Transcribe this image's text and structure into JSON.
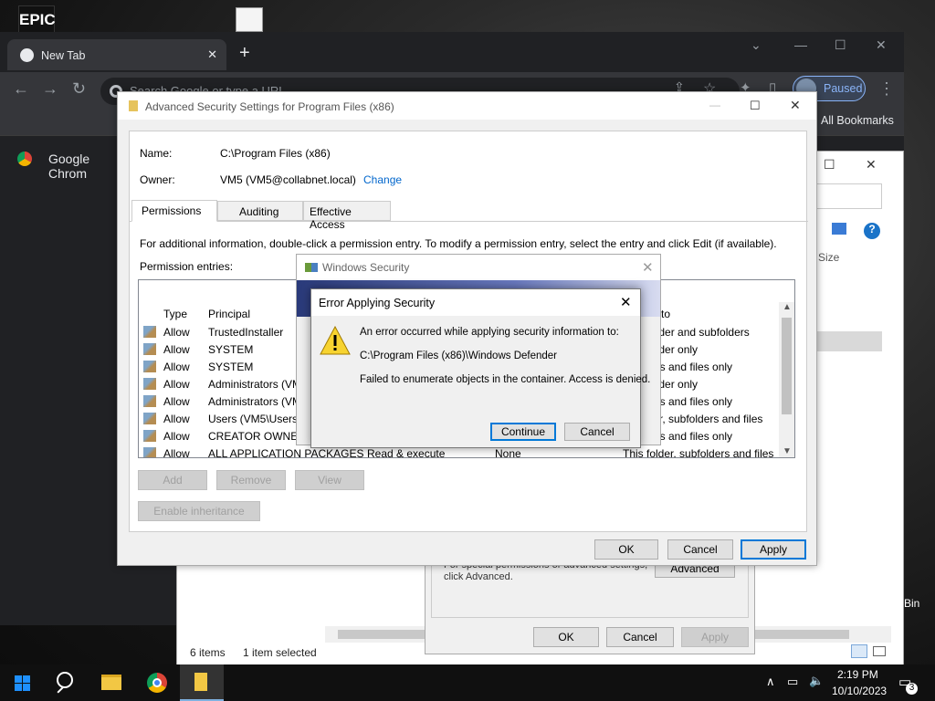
{
  "desktop": {
    "epic_label": "EPIC",
    "recycle_bin_label": "Bin"
  },
  "chrome": {
    "tab_title": "New Tab",
    "omnibox_placeholder": "Search Google or type a URL",
    "profile_status": "Paused",
    "all_bookmarks": "All Bookmarks",
    "history_item": "Google Chrom"
  },
  "explorer": {
    "size_header": "Size",
    "items_count": "6 items",
    "selection": "1 item selected"
  },
  "properties": {
    "advanced_text_1": "For special permissions or advanced settings,",
    "advanced_text_2": "click Advanced.",
    "advanced_button": "Advanced",
    "ok": "OK",
    "cancel": "Cancel",
    "apply": "Apply"
  },
  "advanced_security": {
    "title": "Advanced Security Settings for Program Files (x86)",
    "name_label": "Name:",
    "name_value": "C:\\Program Files (x86)",
    "owner_label": "Owner:",
    "owner_value": "VM5 (VM5@collabnet.local)",
    "change_link": "Change",
    "tabs": [
      "Permissions",
      "Auditing",
      "Effective Access"
    ],
    "info_text": "For additional information, double-click a permission entry. To modify a permission entry, select the entry and click Edit (if available).",
    "permission_entries_label": "Permission entries:",
    "columns": {
      "type": "Type",
      "principal": "Principal",
      "applies_to": "to"
    },
    "rows": [
      {
        "type": "Allow",
        "principal": "TrustedInstaller",
        "access": "",
        "inherited": "",
        "applies": "older and subfolders"
      },
      {
        "type": "Allow",
        "principal": "SYSTEM",
        "access": "",
        "inherited": "",
        "applies": "older only"
      },
      {
        "type": "Allow",
        "principal": "SYSTEM",
        "access": "",
        "inherited": "",
        "applies": "ers and files only"
      },
      {
        "type": "Allow",
        "principal": "Administrators (VM",
        "access": "",
        "inherited": "",
        "applies": "older only"
      },
      {
        "type": "Allow",
        "principal": "Administrators (VM",
        "access": "",
        "inherited": "",
        "applies": "ers and files only"
      },
      {
        "type": "Allow",
        "principal": "Users (VM5\\Users)",
        "access": "",
        "inherited": "",
        "applies": "r, subfolders and files"
      },
      {
        "type": "Allow",
        "principal": "CREATOR OWNER",
        "access": "",
        "inherited": "",
        "applies": "ers and files only"
      },
      {
        "type": "Allow",
        "principal": "ALL APPLICATION PACKAGES",
        "access": "Read & execute",
        "inherited": "None",
        "applies": "This folder, subfolders and files"
      }
    ],
    "add": "Add",
    "remove": "Remove",
    "view": "View",
    "enable_inheritance": "Enable inheritance",
    "ok": "OK",
    "cancel": "Cancel",
    "apply": "Apply"
  },
  "windows_security": {
    "title": "Windows Security"
  },
  "error_dialog": {
    "title": "Error Applying Security",
    "line1": "An error occurred while applying security information to:",
    "line2": "C:\\Program Files (x86)\\Windows Defender",
    "line3": "Failed to enumerate objects in the container. Access is denied.",
    "continue": "Continue",
    "cancel": "Cancel"
  },
  "taskbar": {
    "time": "2:19 PM",
    "date": "10/10/2023",
    "notifications": "3"
  }
}
